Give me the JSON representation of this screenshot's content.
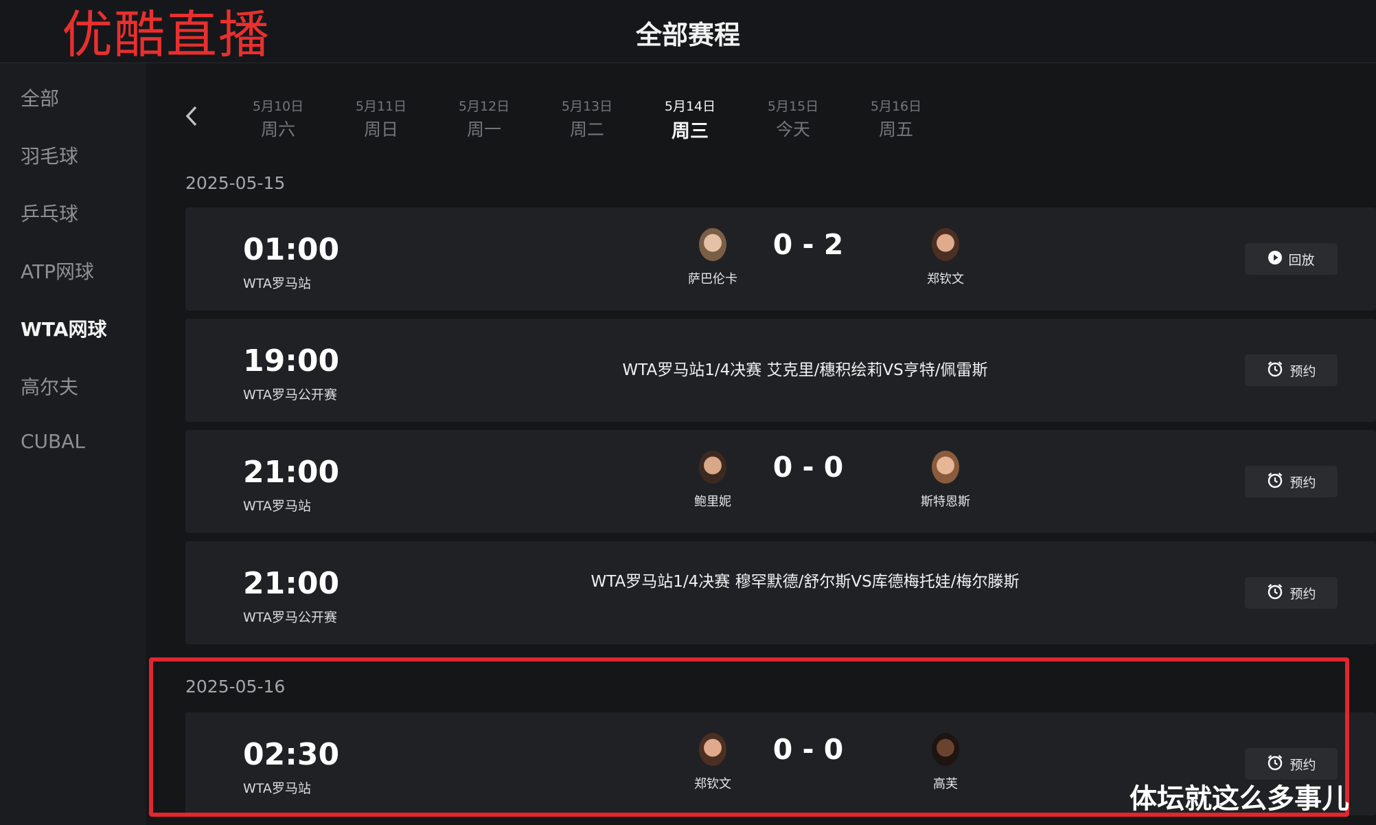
{
  "brand": "优酷直播",
  "page_title": "全部赛程",
  "sidebar": {
    "items": [
      {
        "label": "全部",
        "active": false
      },
      {
        "label": "羽毛球",
        "active": false
      },
      {
        "label": "乒乓球",
        "active": false
      },
      {
        "label": "ATP网球",
        "active": false
      },
      {
        "label": "WTA网球",
        "active": true
      },
      {
        "label": "高尔夫",
        "active": false
      },
      {
        "label": "CUBAL",
        "active": false
      }
    ]
  },
  "date_nav": {
    "back_icon": "chevron-left-icon",
    "days": [
      {
        "date": "5月10日",
        "weekday": "周六"
      },
      {
        "date": "5月11日",
        "weekday": "周日"
      },
      {
        "date": "5月12日",
        "weekday": "周一"
      },
      {
        "date": "5月13日",
        "weekday": "周二"
      },
      {
        "date": "5月14日",
        "weekday": "周三",
        "active": true
      },
      {
        "date": "5月15日",
        "weekday": "今天"
      },
      {
        "date": "5月16日",
        "weekday": "周五"
      }
    ]
  },
  "groups": [
    {
      "date": "2025-05-15",
      "matches": [
        {
          "time": "01:00",
          "league": "WTA罗马站",
          "player1": "萨巴伦卡",
          "score": "0 - 2",
          "player2": "郑钦文",
          "action": "回放",
          "action_icon": "play-circle-icon"
        },
        {
          "time": "19:00",
          "league": "WTA罗马公开赛",
          "title": "WTA罗马站1/4决赛 艾克里/穗积绘莉VS亨特/佩雷斯",
          "action": "预约",
          "action_icon": "alarm-clock-icon"
        },
        {
          "time": "21:00",
          "league": "WTA罗马站",
          "player1": "鲍里妮",
          "score": "0 - 0",
          "player2": "斯特恩斯",
          "action": "预约",
          "action_icon": "alarm-clock-icon"
        },
        {
          "time": "21:00",
          "league": "WTA罗马公开赛",
          "title": "WTA罗马站1/4决赛 穆罕默德/舒尔斯VS库德梅托娃/梅尔滕斯",
          "action": "预约",
          "action_icon": "alarm-clock-icon"
        }
      ]
    },
    {
      "date": "2025-05-16",
      "matches": [
        {
          "time": "02:30",
          "league": "WTA罗马站",
          "player1": "郑钦文",
          "score": "0 - 0",
          "player2": "高芙",
          "action": "预约",
          "action_icon": "alarm-clock-icon"
        }
      ]
    }
  ],
  "watermark": "体坛就这么多事儿",
  "colors": {
    "brand": "#e8302f",
    "highlight_border": "#e1262e",
    "background": "#161719",
    "card": "#202124"
  }
}
